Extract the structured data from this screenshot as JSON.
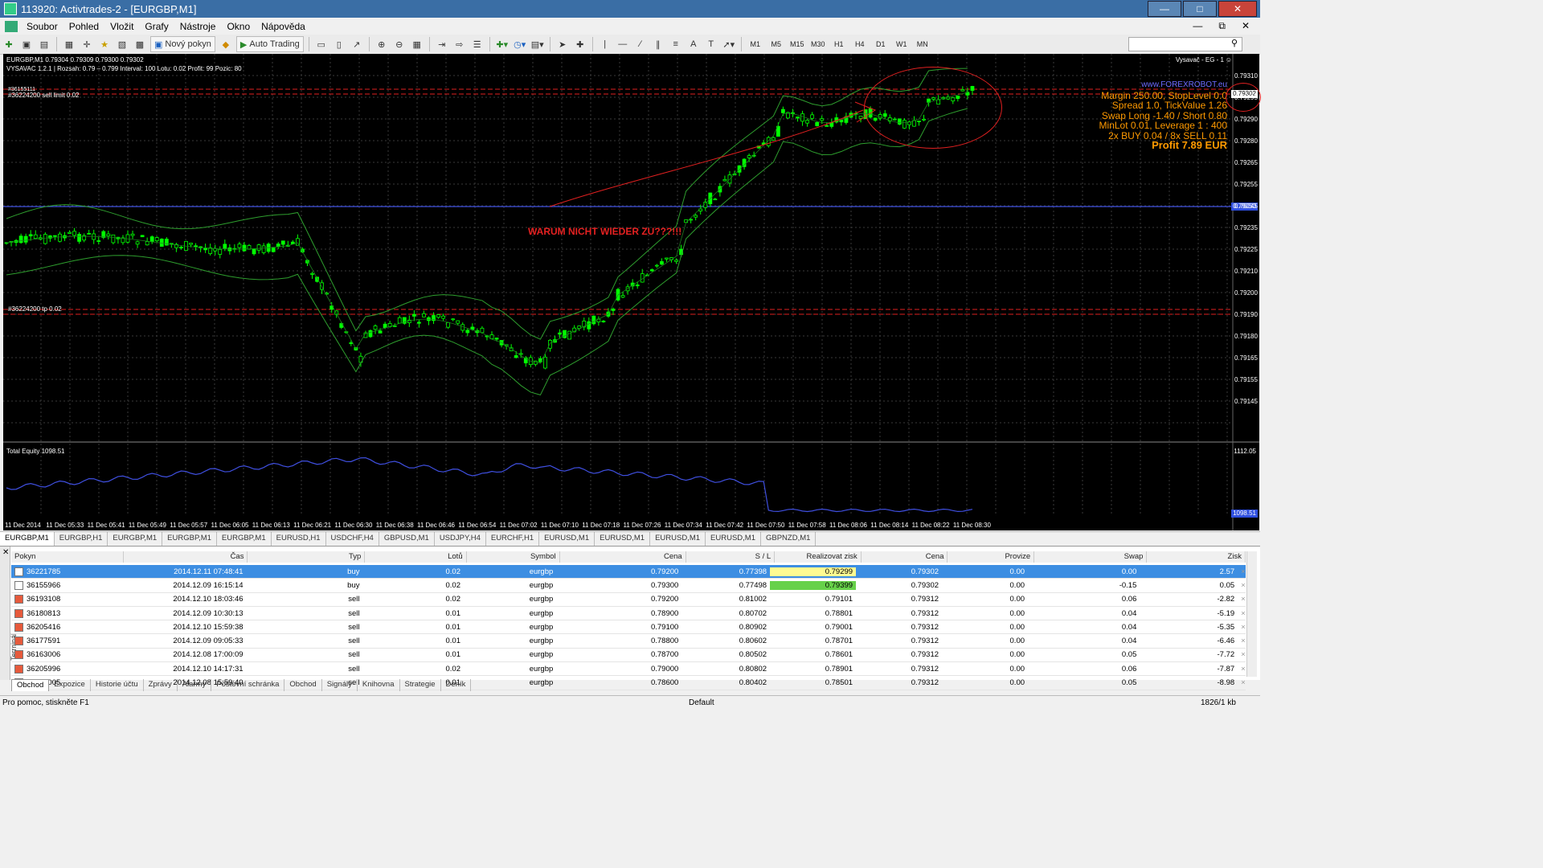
{
  "window": {
    "title": "113920: Activtrades-2 - [EURGBP,M1]"
  },
  "menu": [
    "Soubor",
    "Pohled",
    "Vložit",
    "Grafy",
    "Nástroje",
    "Okno",
    "Nápověda"
  ],
  "toolbar": {
    "new_order": "Nový pokyn",
    "auto_trading": "Auto Trading",
    "timeframes": [
      "M1",
      "M5",
      "M15",
      "M30",
      "H1",
      "H4",
      "D1",
      "W1",
      "MN"
    ]
  },
  "chart": {
    "symbol_line": "EURGBP,M1  0.79304 0.79309 0.79300 0.79302",
    "ea_line": "VYSAVAC 1.2.1  |  Rozsah: 0.79 – 0.799   Interval: 100   Lotu: 0.02   Profit: 99   Pozic: 80",
    "ea_label": "Vysavač - EG - 1",
    "order_label_top": "#36224200 sell limit 0.02",
    "order_label_top2": "#36155111",
    "order_label_bottom": "#36224200 tp 0.02",
    "annotation": "WARUM NICHT WIEDER ZU???!!!",
    "info": {
      "url": "www.FOREXROBOT.eu",
      "line1": "Margin 250.00, StopLevel 0.0",
      "line2": "Spread 1.0, TickValue 1.26",
      "line3": "Swap Long -1.40 / Short 0.80",
      "line4": "MinLot 0.01, Leverage 1 : 400",
      "line5": "2x BUY 0.04 / 8x SELL 0.11",
      "profit": "Profit 7.89 EUR"
    },
    "current_price": "0.79302",
    "blue_line_price": "0.79250",
    "price_ticks": [
      "0.79310",
      "0.79295",
      "0.79290",
      "0.79280",
      "0.79265",
      "0.79255",
      "0.79245",
      "0.79235",
      "0.79225",
      "0.79210",
      "0.79200",
      "0.79190",
      "0.79180",
      "0.79165",
      "0.79155",
      "0.79145"
    ],
    "subwindow": {
      "label": "Total Equity 1098.51",
      "top_value": "1112.05",
      "current_value": "1098.51"
    },
    "time_ticks": [
      "11 Dec 2014",
      "11 Dec 05:33",
      "11 Dec 05:41",
      "11 Dec 05:49",
      "11 Dec 05:57",
      "11 Dec 06:05",
      "11 Dec 06:13",
      "11 Dec 06:21",
      "11 Dec 06:30",
      "11 Dec 06:38",
      "11 Dec 06:46",
      "11 Dec 06:54",
      "11 Dec 07:02",
      "11 Dec 07:10",
      "11 Dec 07:18",
      "11 Dec 07:26",
      "11 Dec 07:34",
      "11 Dec 07:42",
      "11 Dec 07:50",
      "11 Dec 07:58",
      "11 Dec 08:06",
      "11 Dec 08:14",
      "11 Dec 08:22",
      "11 Dec 08:30"
    ]
  },
  "chart_tabs": [
    "EURGBP,M1",
    "EURGBP,H1",
    "EURGBP,M1",
    "EURGBP,M1",
    "EURGBP,M1",
    "EURUSD,H1",
    "USDCHF,H4",
    "GBPUSD,M1",
    "USDJPY,H4",
    "EURCHF,H1",
    "EURUSD,M1",
    "EURUSD,M1",
    "EURUSD,M1",
    "EURUSD,M1",
    "GBPNZD,M1"
  ],
  "terminal": {
    "side_label": "Terminál",
    "columns": [
      "Pokyn",
      "Čas",
      "Typ",
      "Lotů",
      "Symbol",
      "Cena",
      "S / L",
      "Realizovat zisk",
      "Cena",
      "Provize",
      "Swap",
      "Zisk"
    ],
    "rows": [
      [
        "36221785",
        "2014.12.11 07:48:41",
        "buy",
        "0.02",
        "eurgbp",
        "0.79200",
        "0.77398",
        "0.79299",
        "0.79302",
        "0.00",
        "0.00",
        "2.57"
      ],
      [
        "36155966",
        "2014.12.09 16:15:14",
        "buy",
        "0.02",
        "eurgbp",
        "0.79300",
        "0.77498",
        "0.79399",
        "0.79302",
        "0.00",
        "-0.15",
        "0.05"
      ],
      [
        "36193108",
        "2014.12.10 18:03:46",
        "sell",
        "0.02",
        "eurgbp",
        "0.79200",
        "0.81002",
        "0.79101",
        "0.79312",
        "0.00",
        "0.06",
        "-2.82"
      ],
      [
        "36180813",
        "2014.12.09 10:30:13",
        "sell",
        "0.01",
        "eurgbp",
        "0.78900",
        "0.80702",
        "0.78801",
        "0.79312",
        "0.00",
        "0.04",
        "-5.19"
      ],
      [
        "36205416",
        "2014.12.10 15:59:38",
        "sell",
        "0.01",
        "eurgbp",
        "0.79100",
        "0.80902",
        "0.79001",
        "0.79312",
        "0.00",
        "0.04",
        "-5.35"
      ],
      [
        "36177591",
        "2014.12.09 09:05:33",
        "sell",
        "0.01",
        "eurgbp",
        "0.78800",
        "0.80602",
        "0.78701",
        "0.79312",
        "0.00",
        "0.04",
        "-6.46"
      ],
      [
        "36163006",
        "2014.12.08 17:00:09",
        "sell",
        "0.01",
        "eurgbp",
        "0.78700",
        "0.80502",
        "0.78601",
        "0.79312",
        "0.00",
        "0.05",
        "-7.72"
      ],
      [
        "36205996",
        "2014.12.10 14:17:31",
        "sell",
        "0.02",
        "eurgbp",
        "0.79000",
        "0.80802",
        "0.78901",
        "0.79312",
        "0.00",
        "0.06",
        "-7.87"
      ],
      [
        "36163005",
        "2014.12.08 15:59:40",
        "sell",
        "0.01",
        "eurgbp",
        "0.78600",
        "0.80402",
        "0.78501",
        "0.79312",
        "0.00",
        "0.05",
        "-8.98"
      ]
    ],
    "tabs": [
      "Obchod",
      "Expozice",
      "Historie účtu",
      "Zprávy",
      "Alarmy",
      "Poštovní schránka",
      "Obchod",
      "Signály",
      "Knihovna",
      "Strategie",
      "Deník"
    ]
  },
  "status": {
    "help": "Pro pomoc, stiskněte F1",
    "profile": "Default",
    "traffic": "1826/1 kb"
  },
  "colors": {
    "chart_bg": "#000000",
    "candle": "#00ff00",
    "band": "#2e9e2e",
    "equity": "#3f4fe0",
    "order_line": "#e02020",
    "info_text": "#ff9a00",
    "selection": "#3d8ee2"
  }
}
